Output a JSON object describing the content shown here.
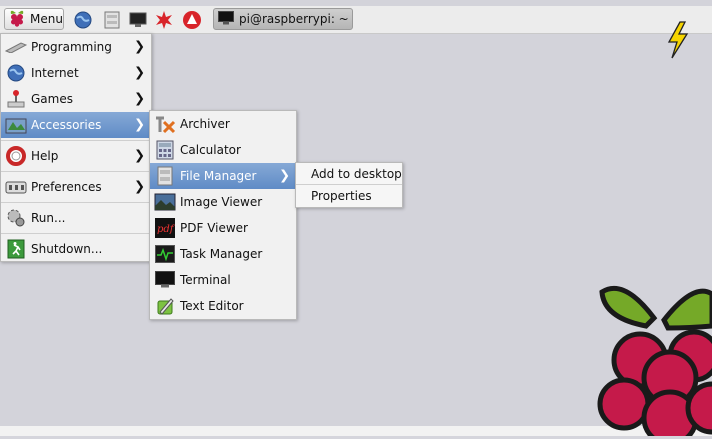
{
  "taskbar": {
    "menu_label": "Menu",
    "launchers": [
      "web-browser-icon",
      "file-manager-icon",
      "terminal-icon",
      "wolfram-icon",
      "mathematica-icon"
    ],
    "window_button": "pi@raspberrypi: ~"
  },
  "main_menu": {
    "items": [
      {
        "label": "Programming",
        "icon": "programming-icon",
        "submenu": true
      },
      {
        "label": "Internet",
        "icon": "internet-icon",
        "submenu": true
      },
      {
        "label": "Games",
        "icon": "games-icon",
        "submenu": true
      },
      {
        "label": "Accessories",
        "icon": "accessories-icon",
        "submenu": true,
        "selected": true
      },
      {
        "label": "Help",
        "icon": "help-icon",
        "submenu": true
      },
      {
        "label": "Preferences",
        "icon": "preferences-icon",
        "submenu": true
      },
      {
        "label": "Run...",
        "icon": "run-icon"
      },
      {
        "label": "Shutdown...",
        "icon": "shutdown-icon"
      }
    ]
  },
  "accessories_menu": {
    "items": [
      {
        "label": "Archiver",
        "icon": "archiver-icon"
      },
      {
        "label": "Calculator",
        "icon": "calculator-icon"
      },
      {
        "label": "File Manager",
        "icon": "file-manager-icon",
        "submenu": true,
        "selected": true
      },
      {
        "label": "Image Viewer",
        "icon": "image-viewer-icon"
      },
      {
        "label": "PDF Viewer",
        "icon": "pdf-viewer-icon"
      },
      {
        "label": "Task Manager",
        "icon": "task-manager-icon"
      },
      {
        "label": "Terminal",
        "icon": "terminal-icon"
      },
      {
        "label": "Text Editor",
        "icon": "text-editor-icon"
      }
    ]
  },
  "context_menu": {
    "items": [
      {
        "label": "Add to desktop"
      },
      {
        "label": "Properties"
      }
    ]
  },
  "colors": {
    "desktop": "#d3d3da",
    "selection": "#6f96cd",
    "menu_bg": "#f1f1f1",
    "raspberry_red": "#c51a4a",
    "leaf_green": "#75a928",
    "lightning": "#f5d400"
  }
}
